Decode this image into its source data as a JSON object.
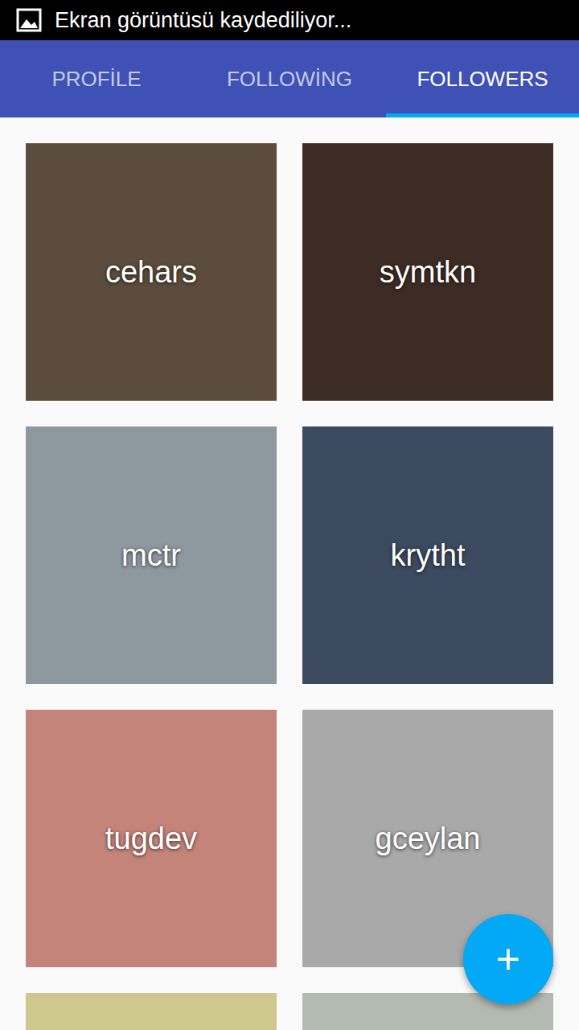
{
  "status_bar": {
    "text": "Ekran görüntüsü kaydediliyor..."
  },
  "tabs": [
    {
      "label": "PROFİLE",
      "selected": false
    },
    {
      "label": "FOLLOWİNG",
      "selected": false
    },
    {
      "label": "FOLLOWERS",
      "selected": true
    }
  ],
  "followers": [
    {
      "name": "cehars",
      "color": "#5b4c3e"
    },
    {
      "name": "symtkn",
      "color": "#3d2c24"
    },
    {
      "name": "mctr",
      "color": "#8e989f"
    },
    {
      "name": "krytht",
      "color": "#3b4a5e"
    },
    {
      "name": "tugdev",
      "color": "#c4847a"
    },
    {
      "name": "gceylan",
      "color": "#a9a9a9"
    },
    {
      "name": "",
      "color": "#cfc88c"
    },
    {
      "name": "",
      "color": "#b3bab2"
    }
  ],
  "fab": {
    "label": "+"
  }
}
